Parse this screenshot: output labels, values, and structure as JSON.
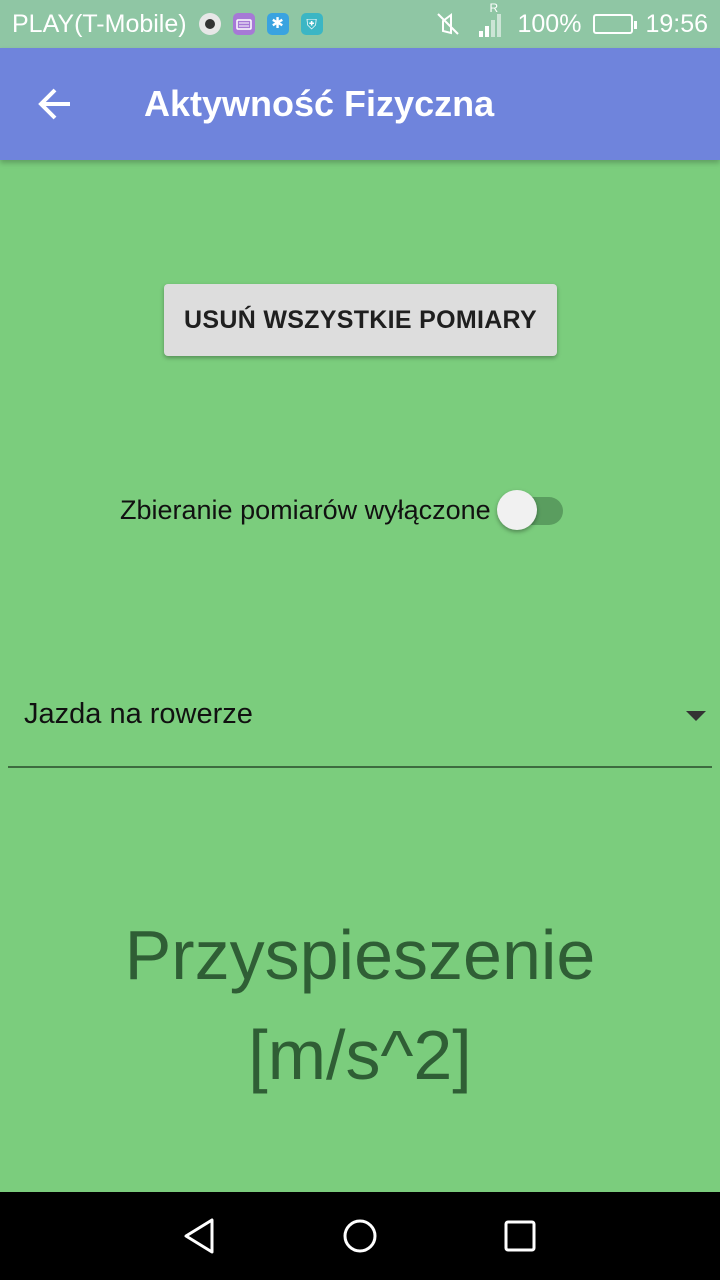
{
  "status_bar": {
    "carrier": "PLAY(T-Mobile)",
    "battery_percent": "100%",
    "time": "19:56",
    "roaming_indicator": "R",
    "icons": [
      "camera-icon",
      "keyboard-icon",
      "bluetooth-icon",
      "shield-icon",
      "mute-icon",
      "signal-icon",
      "battery-icon"
    ]
  },
  "app_bar": {
    "title": "Aktywność Fizyczna",
    "back_icon": "arrow-back-icon"
  },
  "actions": {
    "delete_all_label": "USUŃ WSZYSTKIE POMIARY"
  },
  "measurement_switch": {
    "label": "Zbieranie pomiarów wyłączone",
    "checked": false
  },
  "activity_spinner": {
    "selected": "Jazda na rowerze"
  },
  "heading": {
    "text": "Przyspieszenie [m/s^2]"
  },
  "nav_bar": {
    "icons": [
      "back-triangle-icon",
      "home-circle-icon",
      "recents-square-icon"
    ]
  },
  "colors": {
    "background": "#7bcd7d",
    "app_bar": "#6f84dc",
    "status_bar": "#8fc6a4",
    "heading_text": "#2f5e35"
  }
}
